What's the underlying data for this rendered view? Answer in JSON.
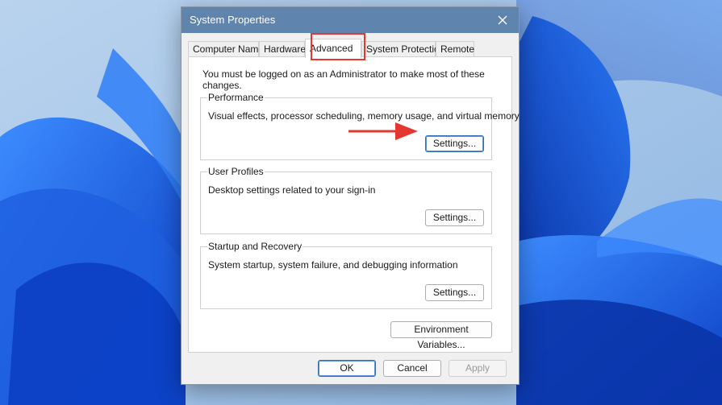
{
  "dialog": {
    "title": "System Properties",
    "tabs": [
      {
        "label": "Computer Name"
      },
      {
        "label": "Hardware"
      },
      {
        "label": "Advanced"
      },
      {
        "label": "System Protection"
      },
      {
        "label": "Remote"
      }
    ],
    "active_tab": "Advanced",
    "admin_note": "You must be logged on as an Administrator to make most of these changes.",
    "groups": {
      "performance": {
        "label": "Performance",
        "description": "Visual effects, processor scheduling, memory usage, and virtual memory",
        "button": "Settings..."
      },
      "user_profiles": {
        "label": "User Profiles",
        "description": "Desktop settings related to your sign-in",
        "button": "Settings..."
      },
      "startup_recovery": {
        "label": "Startup and Recovery",
        "description": "System startup, system failure, and debugging information",
        "button": "Settings..."
      }
    },
    "env_button": "Environment Variables...",
    "footer": {
      "ok": "OK",
      "cancel": "Cancel",
      "apply": "Apply"
    }
  },
  "colors": {
    "titlebar": "#5f84ad",
    "highlight_red": "#e3372f",
    "wallpaper_blue": "#1f5fe0"
  },
  "icons": {
    "close": "close-icon",
    "arrow": "arrow-right-icon"
  }
}
